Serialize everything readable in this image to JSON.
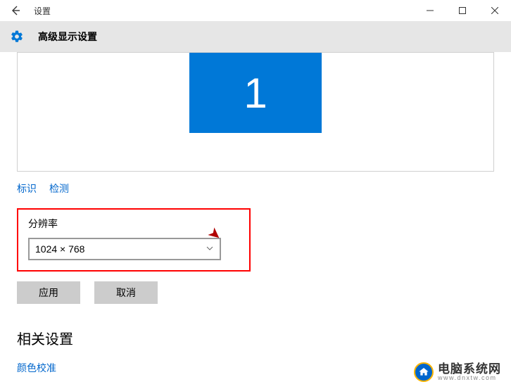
{
  "titlebar": {
    "title": "设置"
  },
  "header": {
    "page_title": "高级显示设置"
  },
  "displays": {
    "monitor1_label": "1"
  },
  "links": {
    "identify": "标识",
    "detect": "检测"
  },
  "resolution": {
    "label": "分辨率",
    "value": "1024 × 768"
  },
  "buttons": {
    "apply": "应用",
    "cancel": "取消"
  },
  "related": {
    "heading": "相关设置",
    "color_calibration": "颜色校准"
  },
  "watermark": {
    "main": "电脑系统网",
    "sub": "www.dnxtw.com"
  }
}
